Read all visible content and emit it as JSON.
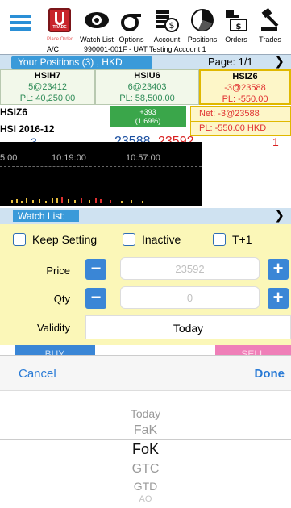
{
  "toolbar": {
    "menu_icon": "hamburger-menu-icon",
    "items": [
      {
        "label": "Place Order",
        "icon": "trade-icon"
      },
      {
        "label": "Watch List",
        "icon": "eye-icon"
      },
      {
        "label": "Options",
        "icon": "sigma-icon"
      },
      {
        "label": "Account",
        "icon": "coins-icon"
      },
      {
        "label": "Positions",
        "icon": "pie-chart-icon"
      },
      {
        "label": "Orders",
        "icon": "orders-icon"
      },
      {
        "label": "Trades",
        "icon": "gavel-icon"
      }
    ],
    "trade_badge": "TRADE",
    "account_label": "A/C",
    "account_value": "990001-001F - UAT Testing Account 1"
  },
  "positions": {
    "title": "Your Positions (3) , HKD",
    "page": "Page: 1/1",
    "items": [
      {
        "symbol": "HSIH7",
        "qty": "5@23412",
        "pl": "PL: 40,250.00"
      },
      {
        "symbol": "HSIU6",
        "qty": "6@23403",
        "pl": "PL: 58,500.00"
      },
      {
        "symbol": "HSIZ6",
        "qty": "-3@23588",
        "pl": "PL: -550.00"
      }
    ]
  },
  "quote": {
    "symbol": "HSIZ6",
    "name": "HSI 2016-12",
    "change": "+393",
    "change_pct": "(1.69%)",
    "net": "Net: -3@23588",
    "pl": "PL: -550.00 HKD",
    "bid_qty": "3",
    "bid": "23588",
    "ask": "23592",
    "ask_qty": "1"
  },
  "chart": {
    "ticks": [
      "5:00",
      "10:19:00",
      "10:57:00"
    ]
  },
  "watch_list": {
    "title": "Watch List:"
  },
  "order": {
    "keep_setting": "Keep Setting",
    "inactive": "Inactive",
    "t1": "T+1",
    "price_label": "Price",
    "price_value": "23592",
    "qty_label": "Qty",
    "qty_value": "0",
    "validity_label": "Validity",
    "validity_value": "Today",
    "buy_label": "BUY",
    "sell_label": "SELL"
  },
  "picker": {
    "cancel": "Cancel",
    "done": "Done",
    "options": [
      "Today",
      "FaK",
      "FoK",
      "GTC",
      "GTD",
      "AO"
    ],
    "selected": "FoK"
  },
  "colors": {
    "accent_blue": "#3a86d6",
    "header_blue": "#cfe2f1",
    "order_yellow": "#fbf7b8",
    "bid_blue": "#1a4fa0",
    "ask_red": "#d82020",
    "sell_pink": "#ef7fb8"
  }
}
